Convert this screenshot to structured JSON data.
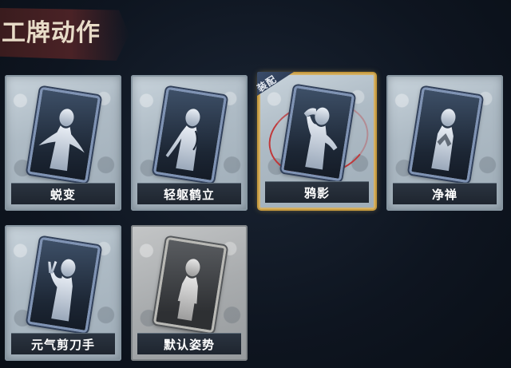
{
  "header": {
    "title": "工牌动作"
  },
  "equip_label": "装配",
  "colors": {
    "accent_gold": "#c69a3e",
    "red_ring": "#c0383a"
  },
  "cards": [
    {
      "label": "蜕变",
      "equipped": false,
      "icon": "figure-arms-open-icon"
    },
    {
      "label": "轻躯鹤立",
      "equipped": false,
      "icon": "figure-crane-pose-icon"
    },
    {
      "label": "鸦影",
      "equipped": true,
      "icon": "figure-hand-on-head-icon"
    },
    {
      "label": "净禅",
      "equipped": false,
      "icon": "figure-prayer-icon"
    },
    {
      "label": "元气剪刀手",
      "equipped": false,
      "icon": "figure-peace-sign-icon"
    },
    {
      "label": "默认姿势",
      "equipped": false,
      "icon": "figure-default-icon"
    }
  ]
}
